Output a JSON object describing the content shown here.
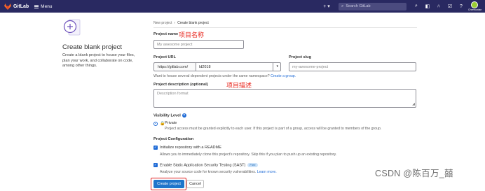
{
  "nav": {
    "brand": "GitLab",
    "menu_label": "Menu",
    "new_label": "+ ▾",
    "search_placeholder": "Search GitLab",
    "icons": [
      "search-icon",
      "issues-icon",
      "merge-requests-icon",
      "todos-icon",
      "help-icon"
    ],
    "avatar_name": "Chenwuxian"
  },
  "left": {
    "title": "Create blank project",
    "description": "Create a blank project to house your files, plan your work, and collaborate on code, among other things."
  },
  "breadcrumb": [
    "New project",
    "Create blank project"
  ],
  "form": {
    "project_name_label": "Project name",
    "project_name_annotation": "项目名称",
    "project_name_placeholder": "My awesome project",
    "project_url_label": "Project URL",
    "url_prefix": "https://gitlab.com/",
    "namespace_value": "ld2018",
    "project_slug_label": "Project slug",
    "slug_placeholder": "my-awesome-project",
    "namespace_help": "Want to house several dependent projects under the same namespace?",
    "create_group_link": "Create a group.",
    "description_label": "Project description (optional)",
    "description_annotation": "项目描述",
    "description_placeholder": "Description format",
    "visibility_label": "Visibility Level",
    "visibility_option": "Private",
    "visibility_help": "Project access must be granted explicitly to each user. If this project is part of a group, access will be granted to members of the group.",
    "config_label": "Project Configuration",
    "readme_label": "Initialize repository with a README",
    "readme_help": "Allows you to immediately clone this project's repository. Skip this if you plan to push up an existing repository.",
    "sast_label": "Enable Static Application Security Testing (SAST)",
    "sast_badge": "Free",
    "sast_help": "Analyze your source code for known security vulnerabilities.",
    "learn_more_link": "Learn more.",
    "create_button": "Create project",
    "cancel_button": "Cancel"
  },
  "watermark": "CSDN @陈百万_囍",
  "colors": {
    "nav_bg": "#292961",
    "primary": "#1f75cb",
    "annotation": "#e8231a"
  }
}
